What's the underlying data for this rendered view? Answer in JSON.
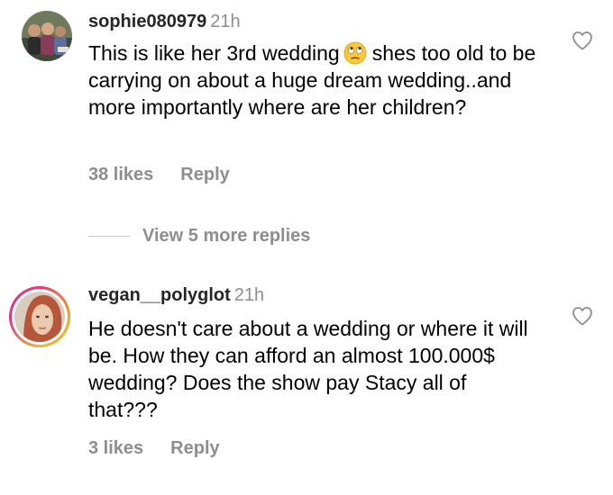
{
  "comments": [
    {
      "username": "sophie080979",
      "timestamp": "21h",
      "text_part1": "This is like her 3rd wedding",
      "emoji": "face-with-rolling-eyes-emoji",
      "text_part2": "shes too old to be carrying on about a huge dream wedding..and more importantly where are her children?",
      "likes": "38 likes",
      "reply_label": "Reply",
      "like_icon": "heart-outline-icon"
    },
    {
      "username": "vegan__polyglot",
      "timestamp": "21h",
      "text": "He doesn't care about a wedding or where it will be. How they can afford an almost 100.000$ wedding? Does the show pay Stacy all of that???",
      "likes": "3 likes",
      "reply_label": "Reply",
      "like_icon": "heart-outline-icon"
    }
  ],
  "view_more_replies": "View 5 more replies",
  "colors": {
    "username": "#262626",
    "secondary": "#8e8e8e",
    "divider": "#c7c7c7",
    "story_ring_start": "#e23d6f",
    "story_ring_end": "#f5a623"
  }
}
